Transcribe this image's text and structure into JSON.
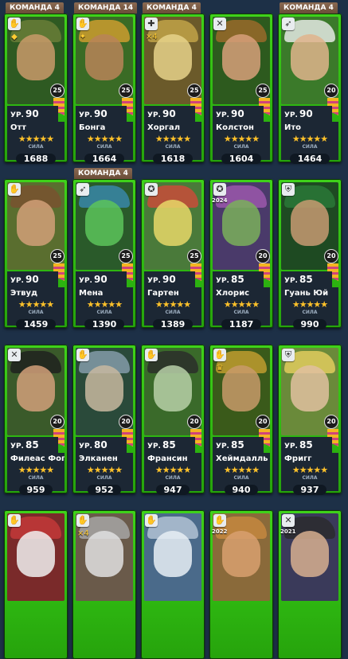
{
  "labels": {
    "level_prefix": "УР.",
    "power": "СИЛА",
    "stars": "★★★★★"
  },
  "heroes": [
    {
      "team": "КОМАНДА 4",
      "level": "90",
      "name": "Отт",
      "power": "1688",
      "badge": "25",
      "class_icon": "✋",
      "sub_icon": "◆",
      "portrait_bg": "#2e5a22",
      "face": "#c99a6a",
      "hat": "#6d7f3a"
    },
    {
      "team": "КОМАНДА 14",
      "level": "90",
      "name": "Бонга",
      "power": "1664",
      "badge": "25",
      "class_icon": "✋",
      "sub_icon": "✦",
      "portrait_bg": "#3a6b25",
      "face": "#b88458",
      "hat": "#d6a030"
    },
    {
      "team": "КОМАНДА 4",
      "level": "90",
      "name": "Хоргал",
      "power": "1618",
      "badge": "25",
      "class_icon": "✚",
      "sub_icon": "×4",
      "portrait_bg": "#6b5a2a",
      "face": "#e6d28a",
      "hat": "#c7a84a"
    },
    {
      "team": "",
      "level": "90",
      "name": "Колстон",
      "power": "1604",
      "badge": "25",
      "class_icon": "✕",
      "sub_icon": "",
      "portrait_bg": "#2d5a1e",
      "face": "#d8a07a",
      "hat": "#a06a2a"
    },
    {
      "team": "КОМАНДА 4",
      "level": "90",
      "name": "Ито",
      "power": "1464",
      "badge": "20",
      "class_icon": "➶",
      "sub_icon": "",
      "portrait_bg": "#3b7a2a",
      "face": "#e0b48c",
      "hat": "#f0f0f0"
    },
    {
      "team": "",
      "level": "90",
      "name": "Этвуд",
      "power": "1459",
      "badge": "25",
      "class_icon": "✋",
      "sub_icon": "",
      "portrait_bg": "#5a6e2f",
      "face": "#d2a078",
      "hat": "#7a5030"
    },
    {
      "team": "КОМАНДА 4",
      "level": "90",
      "name": "Мена",
      "power": "1390",
      "badge": "25",
      "class_icon": "➶",
      "sub_icon": "",
      "portrait_bg": "#2a5a2a",
      "face": "#5cc45a",
      "hat": "#3a8ab0"
    },
    {
      "team": "",
      "level": "90",
      "name": "Гартен",
      "power": "1389",
      "badge": "25",
      "class_icon": "✪",
      "sub_icon": "",
      "portrait_bg": "#4a7a3a",
      "face": "#e8d868",
      "hat": "#d04a3a"
    },
    {
      "team": "",
      "level": "85",
      "name": "Хлорис",
      "power": "1187",
      "badge": "20",
      "class_icon": "✪",
      "sub_icon": "2024",
      "portrait_bg": "#4a3a6a",
      "face": "#7ab05a",
      "hat": "#a05ab0"
    },
    {
      "team": "",
      "level": "85",
      "name": "Гуань Юй",
      "power": "990",
      "badge": "20",
      "class_icon": "⛨",
      "sub_icon": "",
      "portrait_bg": "#1e4a22",
      "face": "#c89a72",
      "hat": "#2a7a3a"
    },
    {
      "team": "",
      "level": "85",
      "name": "Филеас Фогг",
      "power": "959",
      "badge": "20",
      "class_icon": "✕",
      "sub_icon": "",
      "portrait_bg": "#3a5a2a",
      "face": "#d2a07a",
      "hat": "#1e1e1e"
    },
    {
      "team": "",
      "level": "80",
      "name": "Элканен",
      "power": "952",
      "badge": "20",
      "class_icon": "✋",
      "sub_icon": "",
      "portrait_bg": "#2a4a3a",
      "face": "#c8b8a0",
      "hat": "#8aa0b0"
    },
    {
      "team": "",
      "level": "85",
      "name": "Франсин",
      "power": "947",
      "badge": "20",
      "class_icon": "✋",
      "sub_icon": "",
      "portrait_bg": "#3a6a2a",
      "face": "#b8d0a8",
      "hat": "#2a2a2a"
    },
    {
      "team": "",
      "level": "85",
      "name": "Хеймдалль",
      "power": "940",
      "badge": "20",
      "class_icon": "✋",
      "sub_icon": "♛",
      "portrait_bg": "#3a5a1a",
      "face": "#c89a6a",
      "hat": "#c8a030"
    },
    {
      "team": "",
      "level": "85",
      "name": "Фригг",
      "power": "937",
      "badge": "20",
      "class_icon": "⛨",
      "sub_icon": "",
      "portrait_bg": "#6a8a3a",
      "face": "#e0c0a0",
      "hat": "#e8d060"
    },
    {
      "team": "",
      "level": "",
      "name": "",
      "power": "",
      "badge": "",
      "class_icon": "✋",
      "sub_icon": "",
      "portrait_bg": "#7a2a2a",
      "face": "#f0f0f0",
      "hat": "#c83a3a"
    },
    {
      "team": "",
      "level": "",
      "name": "",
      "power": "",
      "badge": "",
      "class_icon": "✋",
      "sub_icon": "×4",
      "portrait_bg": "#6a5a4a",
      "face": "#e0e0e0",
      "hat": "#aaaaaa"
    },
    {
      "team": "",
      "level": "",
      "name": "",
      "power": "",
      "badge": "",
      "class_icon": "✋",
      "sub_icon": "",
      "portrait_bg": "#4a6a8a",
      "face": "#e8eef4",
      "hat": "#b8c8d8"
    },
    {
      "team": "",
      "level": "",
      "name": "",
      "power": "",
      "badge": "",
      "class_icon": "✋",
      "sub_icon": "2022",
      "portrait_bg": "#8a6a3a",
      "face": "#d8a070",
      "hat": "#c88a40"
    },
    {
      "team": "",
      "level": "",
      "name": "",
      "power": "",
      "badge": "",
      "class_icon": "✕",
      "sub_icon": "2021",
      "portrait_bg": "#3a3a5a",
      "face": "#d8b090",
      "hat": "#2a2a2a"
    }
  ]
}
